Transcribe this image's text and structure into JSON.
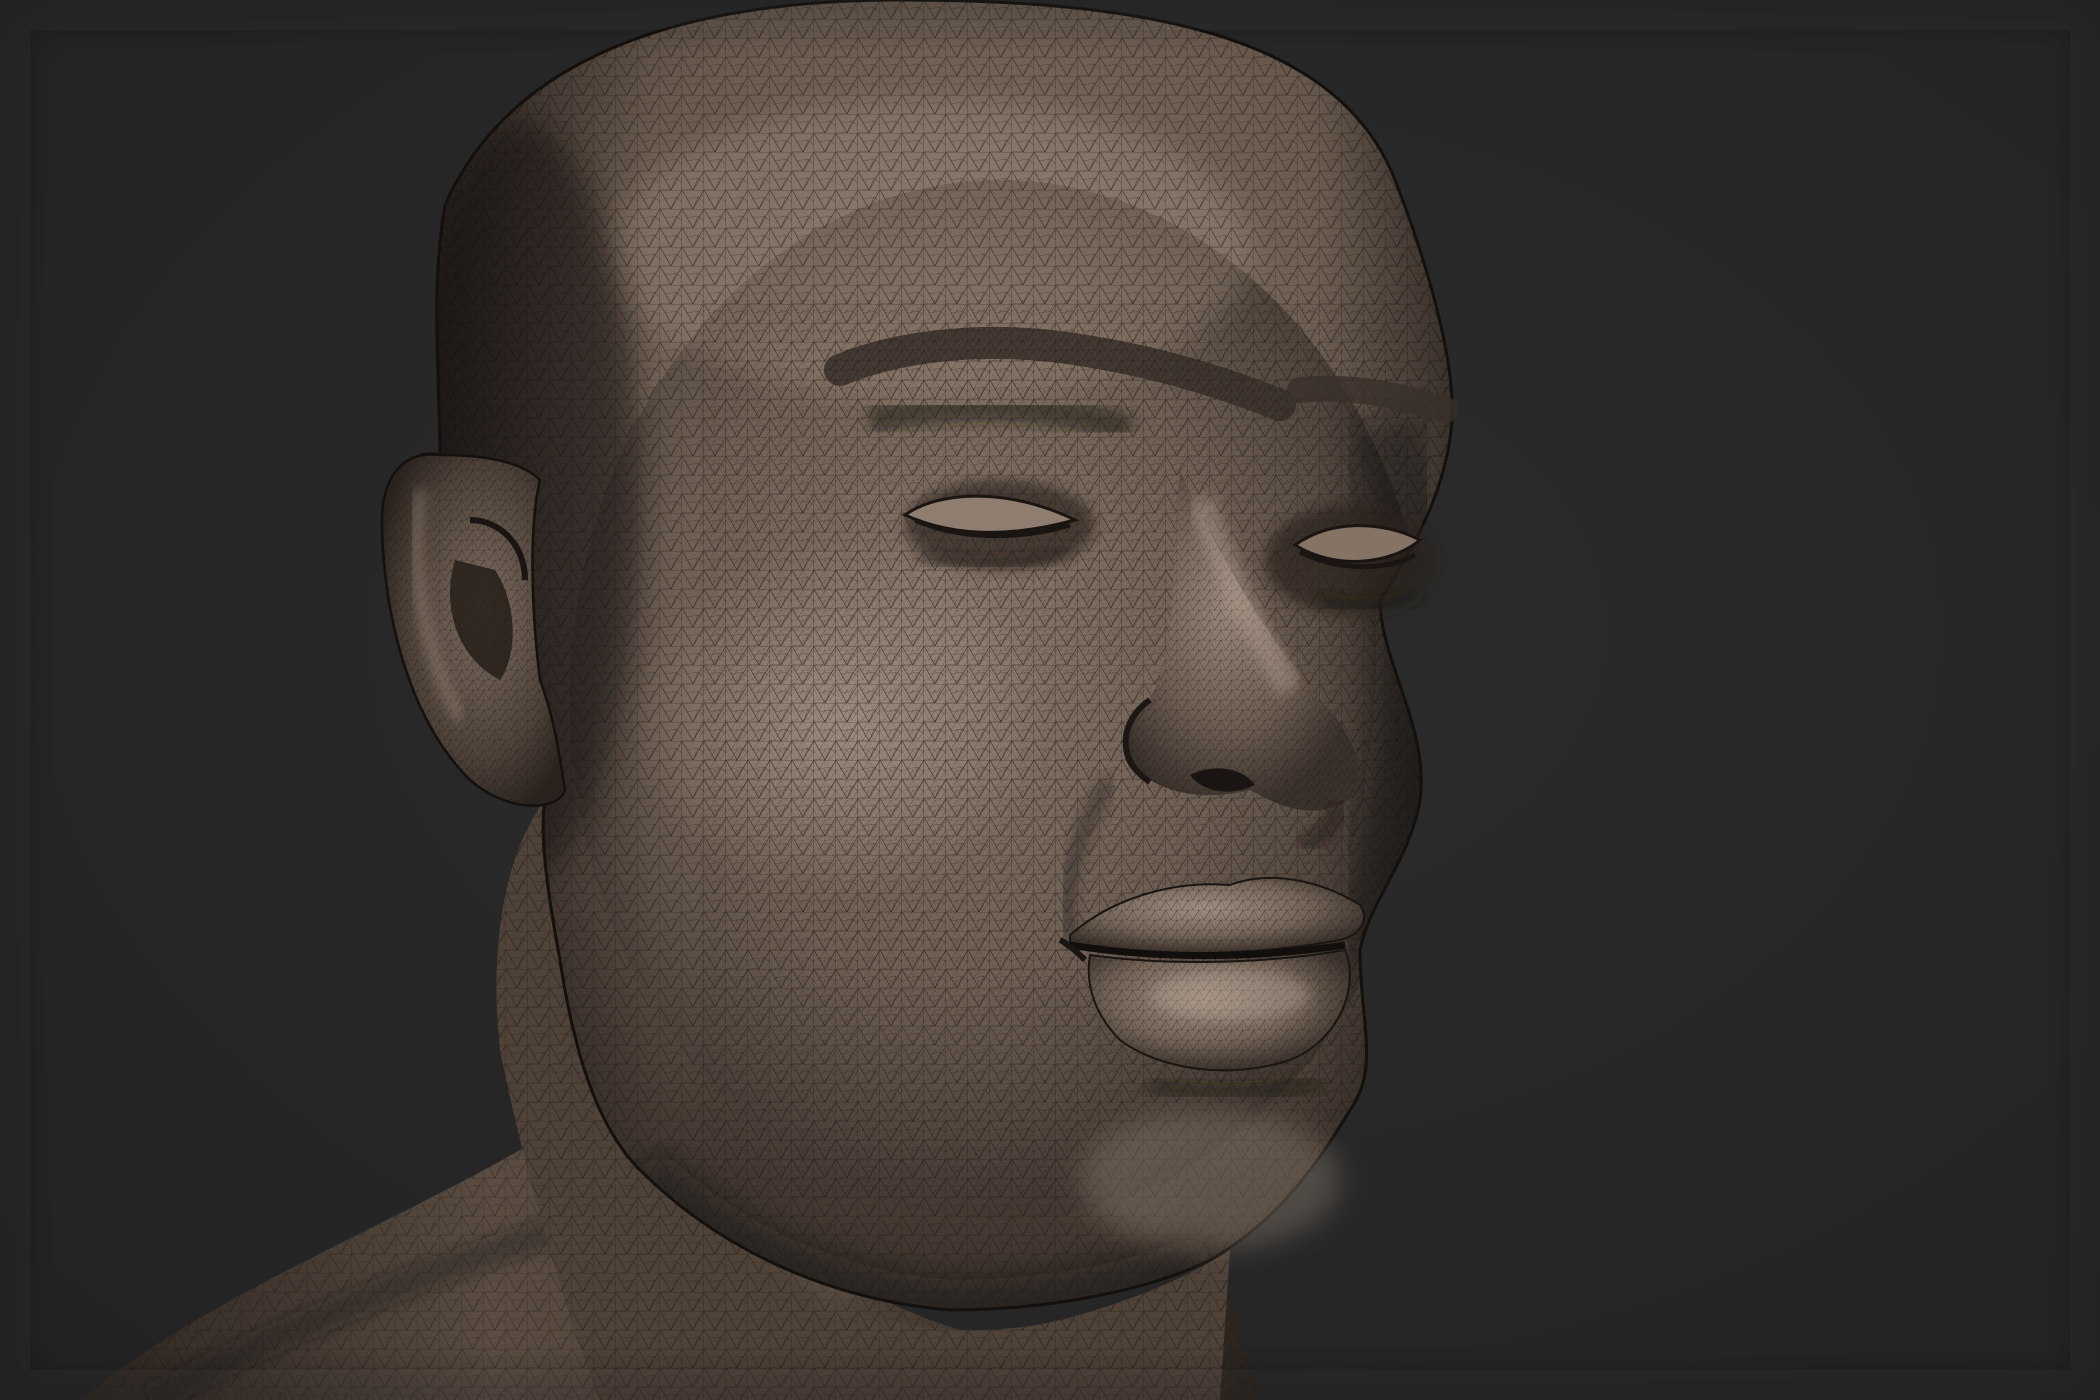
{
  "scene": {
    "subject": "sculpted-head-mesh",
    "background_color": "#262626",
    "surface_color": "#6e5f53",
    "highlight_color": "#a08f80",
    "shadow_color": "#2a231e",
    "wireframe_color": "#1c1714"
  }
}
